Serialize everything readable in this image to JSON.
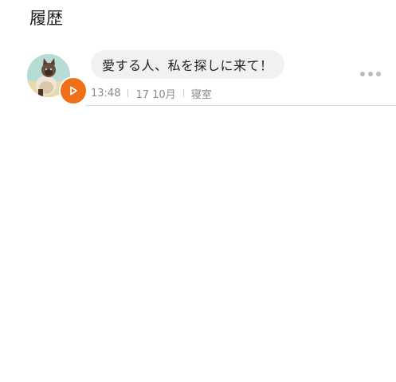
{
  "header": {
    "title": "履歴"
  },
  "history": {
    "items": [
      {
        "avatar_icon": "cat-photo-avatar",
        "play_icon": "play-icon",
        "message": "愛する人、私を探しに来て！",
        "time": "13:48",
        "date": "17 10月",
        "location": "寝室",
        "more_icon": "more-dots-icon"
      }
    ]
  },
  "colors": {
    "accent": "#f07019",
    "bubble_bg": "#f1f1f1",
    "meta_text": "#8a8a8a",
    "divider": "#d6d6d6"
  }
}
